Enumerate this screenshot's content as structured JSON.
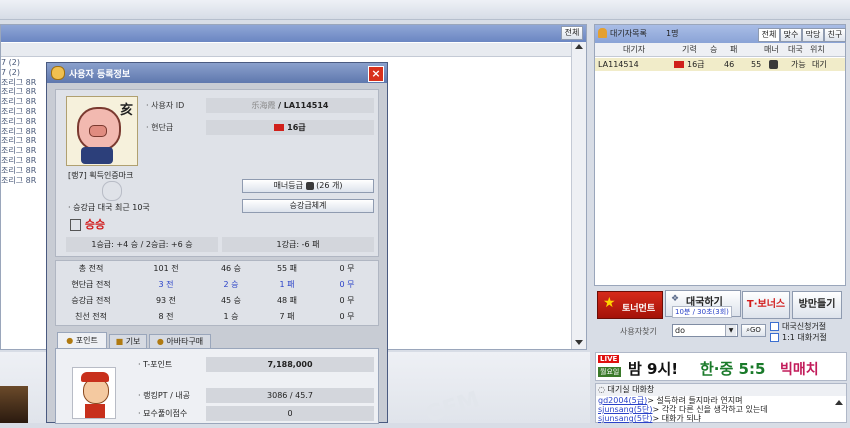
{
  "top_bar": {},
  "left_panel": {
    "header_button": "전체",
    "rooms": [
      "7 (2)",
      "7 (2)",
      "조리그 8R",
      "조리그 8R",
      "조리그 8R",
      "조리그 8R",
      "조리그 8R",
      "조리그 8R",
      "조리그 8R",
      "조리그 8R",
      "조리그 8R",
      "조리그 8R",
      "조리그 8R"
    ]
  },
  "dialog": {
    "title": "사용자 등록정보",
    "profile": {
      "user_id_label": "사용자 ID",
      "user_id_prefix": "乐海霞",
      "user_id_value": "/ LA114514",
      "rank_label": "현단급",
      "rank_value": "16급",
      "zodiac_char": "亥",
      "badge_caption": "[랭7] 획득인증마크",
      "manner_button": "매너등급",
      "manner_count": "(26 개)",
      "promo_system_button": "승강급체계",
      "promo_label": "승강급 대국 최근 10국",
      "promo_result": "승승",
      "promo_line_left": "1승급: +4 승 / 2승급: +6 승",
      "promo_line_right": "1강급: -6 패"
    },
    "records": [
      {
        "label": "총 전적",
        "games": "101 전",
        "wins": "46 승",
        "losses": "55 패",
        "draws": "0 무",
        "highlight": false
      },
      {
        "label": "현단급 전적",
        "games": "3 전",
        "wins": "2 승",
        "losses": "1 패",
        "draws": "0 무",
        "highlight": true
      },
      {
        "label": "승강급 전적",
        "games": "93 전",
        "wins": "45 승",
        "losses": "48 패",
        "draws": "0 무",
        "highlight": false
      },
      {
        "label": "친선 전적",
        "games": "8 전",
        "wins": "1 승",
        "losses": "7 패",
        "draws": "0 무",
        "highlight": false
      }
    ],
    "tabs": [
      "포인트",
      "기보",
      "아바타구매"
    ],
    "points": {
      "tpoint_label": "T-포인트",
      "tpoint_value": "7,188,000",
      "ranking_label": "랭킹PT / 내공",
      "ranking_value": "3086 / 45.7",
      "hidden_label": "묘수풀이점수",
      "hidden_value": "0"
    }
  },
  "right_panel": {
    "waiting_title": "대기자목록",
    "waiting_count": "1명",
    "tabs": [
      "전체",
      "맞수",
      "막당",
      "친구"
    ],
    "columns": [
      "대기자",
      "기력",
      "승",
      "패",
      "매너",
      "대국",
      "위치"
    ],
    "rows": [
      {
        "name": "LA114514",
        "rank": "16급",
        "wins": "46",
        "losses": "55",
        "manner": "",
        "status": "가능",
        "location": "대기"
      }
    ],
    "buttons": {
      "tournament": "토너먼트",
      "play": "대국하기",
      "play_sub": "10분 / 30초(3회)",
      "tbonus": "T·보너스",
      "make_room": "방만들기"
    },
    "search": {
      "label": "사용자찾기",
      "value": "do",
      "go": "GO"
    },
    "checkboxes": [
      "대국신청거절",
      "1:1 대화거절"
    ]
  },
  "banner": {
    "live": "LIVE",
    "day": "월요일",
    "text": "밤 9시!",
    "teams": "한·중 5:5",
    "match": "빅매치"
  },
  "chat": {
    "title": "대기실 대화창",
    "lines": [
      {
        "user": "gd2004(5급)",
        "msg": "> 설득하려 들지마라 연지며"
      },
      {
        "user": "sjunsang(5단)",
        "msg": "> 각각 다른 신을 생각하고 있는데"
      },
      {
        "user": "sjunsang(5단)",
        "msg": "> 대화가 되냐"
      }
    ]
  },
  "watermark": "GEM",
  "colors": {
    "accent": "#2a42c8",
    "alert": "#d21b1b",
    "dialog_title": "#6f87b8"
  }
}
